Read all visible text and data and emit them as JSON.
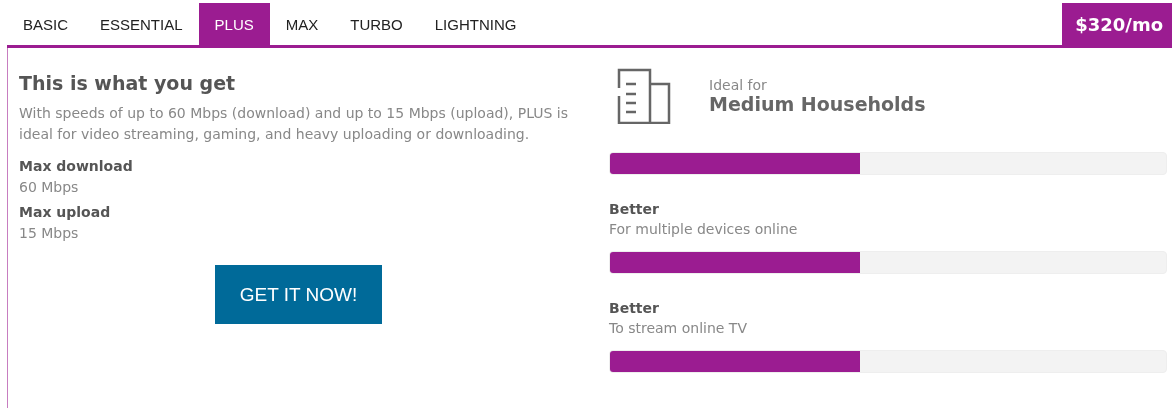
{
  "tabs": [
    {
      "label": "BASIC",
      "selected": false
    },
    {
      "label": "ESSENTIAL",
      "selected": false
    },
    {
      "label": "PLUS",
      "selected": true
    },
    {
      "label": "MAX",
      "selected": false
    },
    {
      "label": "TURBO",
      "selected": false
    },
    {
      "label": "LIGHTNING",
      "selected": false
    }
  ],
  "price": "$320/mo",
  "details": {
    "heading": "This is what you get",
    "description": "With speeds of up to 60 Mbps (download) and up to 15 Mbps (upload), PLUS is ideal for video streaming, gaming, and heavy uploading or downloading.",
    "specs": [
      {
        "label": "Max download",
        "value": "60 Mbps"
      },
      {
        "label": "Max upload",
        "value": "15 Mbps"
      }
    ],
    "button": "GET IT NOW!"
  },
  "ideal": {
    "caption": "Ideal for",
    "title": "Medium Households",
    "level": 0.45
  },
  "ratings": [
    {
      "label": "Better",
      "description": "For multiple devices online",
      "level": 0.45
    },
    {
      "label": "Better",
      "description": "To stream online TV",
      "level": 0.45
    }
  ]
}
